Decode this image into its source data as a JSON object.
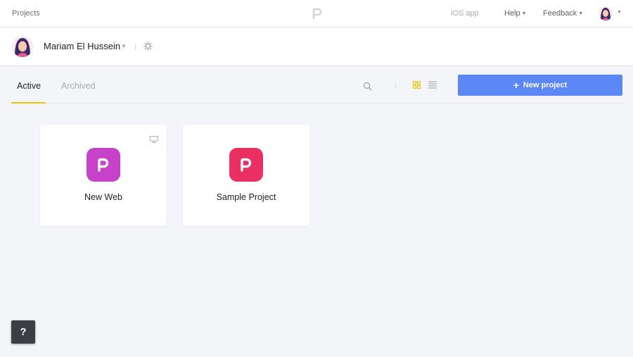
{
  "topbar": {
    "breadcrumb": "Projects",
    "logo_icon": "proto-logo-icon",
    "nav": {
      "ios_app": "iOS app",
      "help": "Help",
      "feedback": "Feedback"
    }
  },
  "account": {
    "username": "Mariam El Hussein"
  },
  "tabs": {
    "active_label": "Active",
    "archived_label": "Archived"
  },
  "toolbar": {
    "new_project_label": "New project",
    "view_mode": "grid"
  },
  "projects": [
    {
      "name": "New Web",
      "color": "#c643c9",
      "device": "desktop"
    },
    {
      "name": "Sample Project",
      "color": "#ea2f63",
      "device": ""
    }
  ],
  "help": {
    "label": "?"
  },
  "colors": {
    "accent": "#5c87f6",
    "tab_indicator": "#f4c300",
    "grid_icon_active": "#f2c200"
  }
}
